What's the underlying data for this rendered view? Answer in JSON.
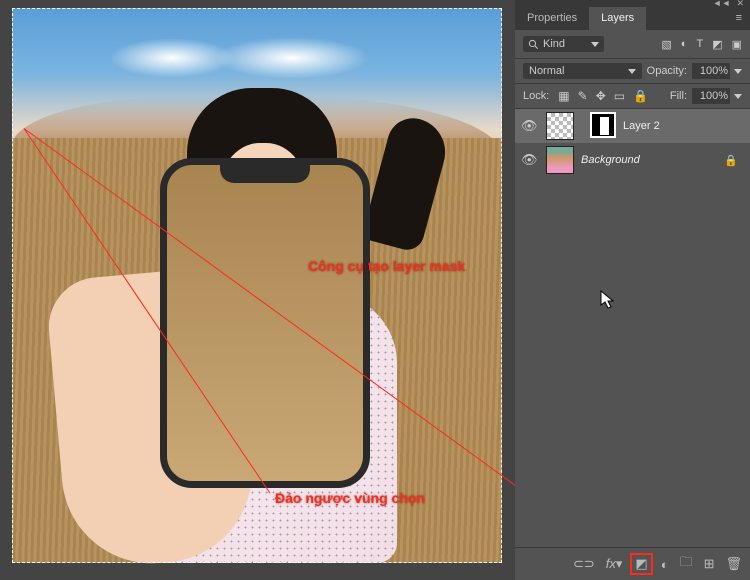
{
  "tabs": {
    "properties": "Properties",
    "layers": "Layers"
  },
  "filter": {
    "kind": "Kind"
  },
  "blend": {
    "mode": "Normal",
    "opacity_lbl": "Opacity:",
    "opacity": "100%",
    "fill_lbl": "Fill:",
    "fill": "100%"
  },
  "lock_lbl": "Lock:",
  "layers": [
    {
      "name": "Layer 2",
      "locked": false,
      "mask": true,
      "italic": false
    },
    {
      "name": "Background",
      "locked": true,
      "mask": false,
      "italic": true
    }
  ],
  "annotations": {
    "tool": "Công cụ tạo layer mask",
    "invert": "Đảo ngược vùng chọn"
  }
}
